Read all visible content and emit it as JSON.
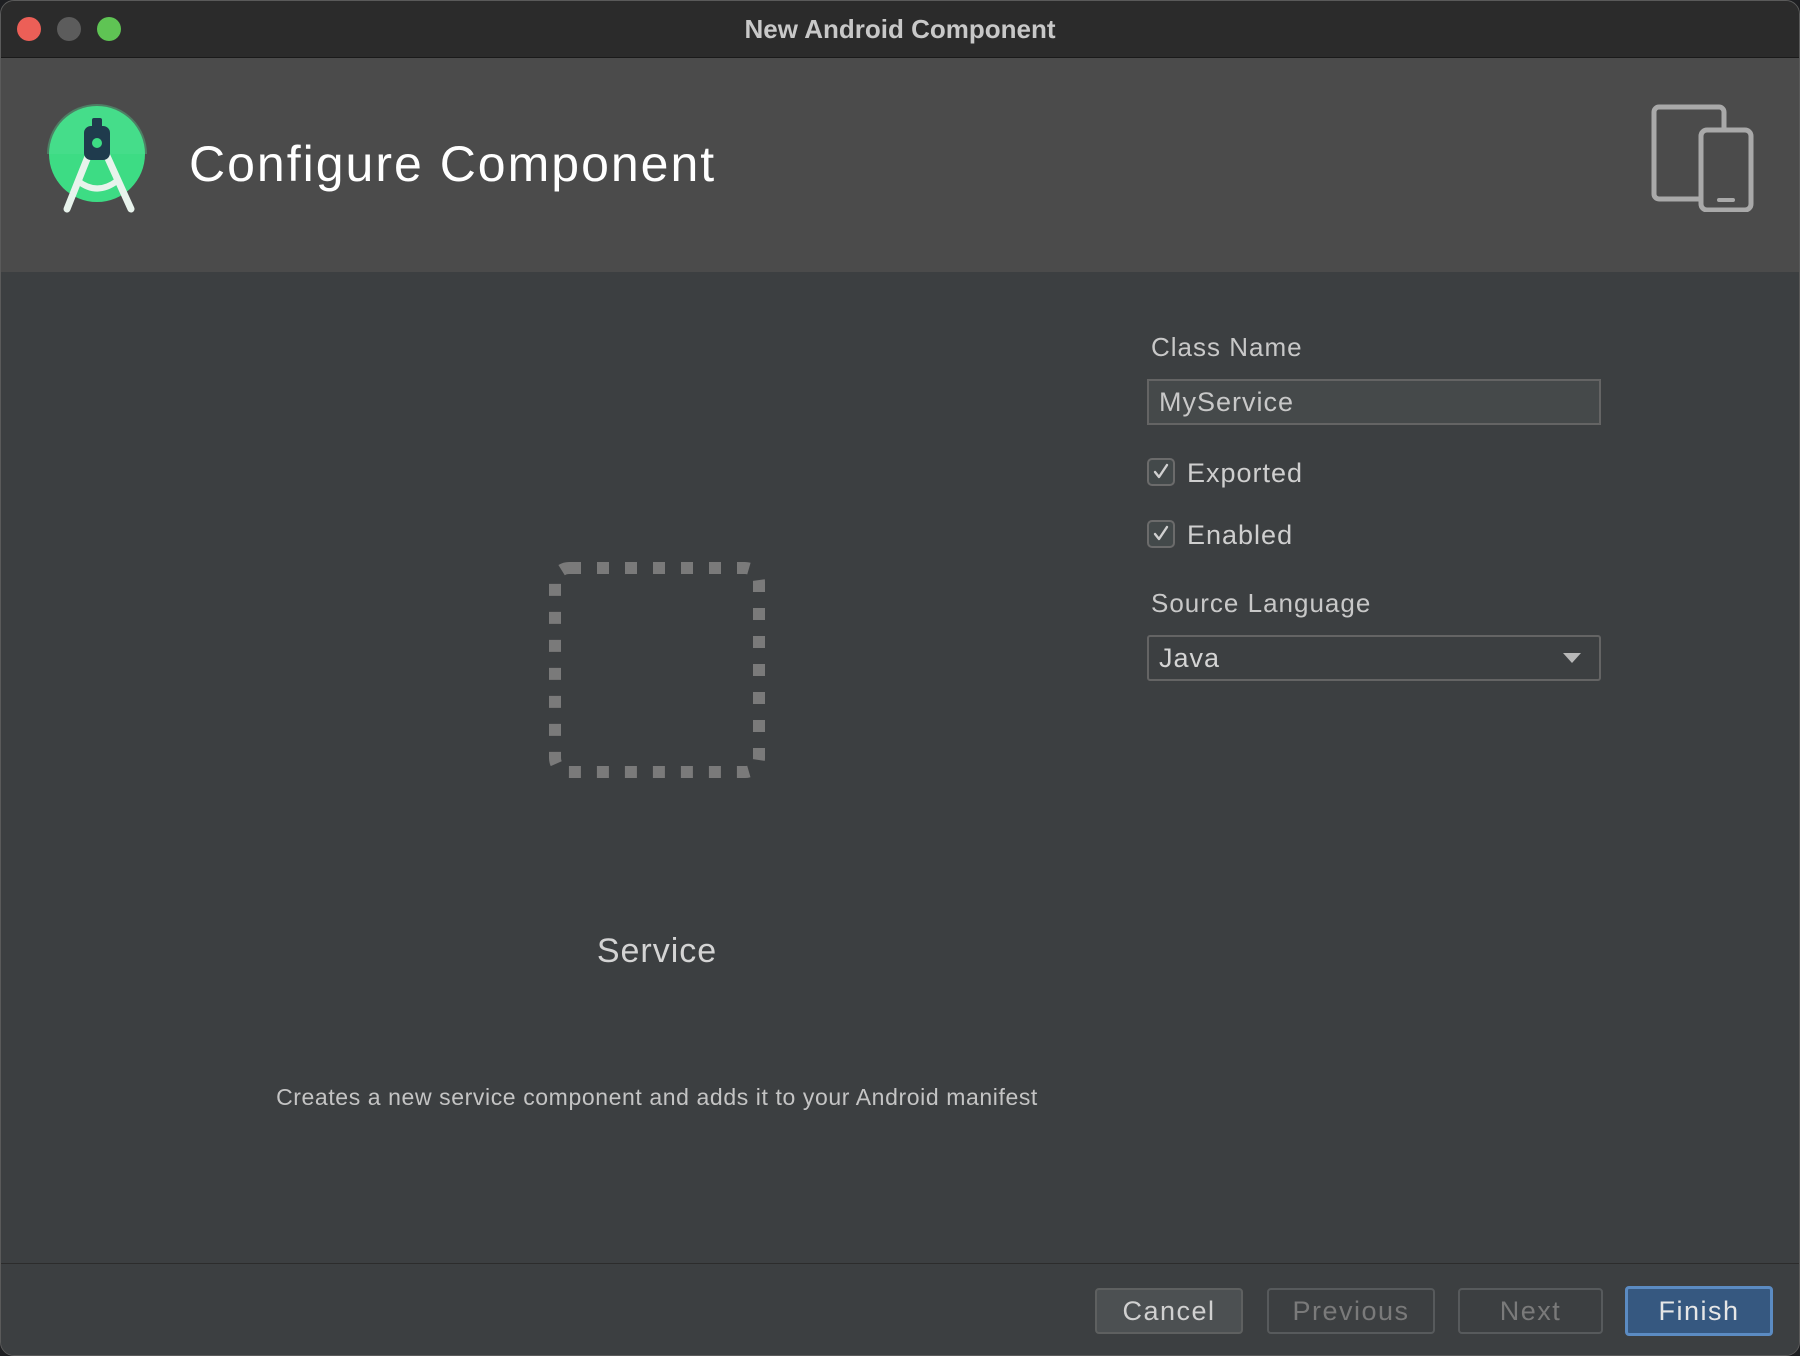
{
  "window": {
    "title": "New Android Component"
  },
  "header": {
    "title": "Configure Component",
    "logo_icon": "android-studio-logo-icon",
    "device_icon": "devices-icon"
  },
  "preview": {
    "icon": "service-dashed-square-icon",
    "name": "Service",
    "description": "Creates a new service component and adds it to your Android manifest"
  },
  "form": {
    "class_name": {
      "label": "Class Name",
      "value": "MyService"
    },
    "exported": {
      "label": "Exported",
      "checked": true
    },
    "enabled": {
      "label": "Enabled",
      "checked": true
    },
    "source_language": {
      "label": "Source Language",
      "value": "Java"
    }
  },
  "footer": {
    "cancel_label": "Cancel",
    "previous_label": "Previous",
    "next_label": "Next",
    "finish_label": "Finish"
  },
  "colors": {
    "window_bg": "#3c3f41",
    "header_bg": "#4b4b4b",
    "titlebar_bg": "#2b2b2b",
    "primary_button": "#365880",
    "primary_button_border": "#5b8bc2",
    "android_green": "#3ddc84"
  }
}
